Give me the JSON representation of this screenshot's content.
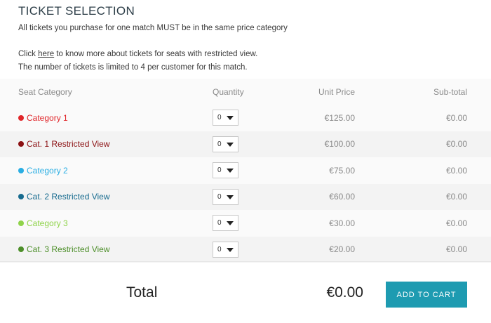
{
  "header": {
    "title": "TICKET SELECTION",
    "line1": "All tickets you purchase for one match MUST be in the same price category",
    "line2_prefix": "Click ",
    "line2_link": "here",
    "line2_suffix": " to know more about tickets for seats with restricted view.",
    "line3": "The number of tickets is limited to 4 per customer for this match."
  },
  "table": {
    "columns": {
      "category": "Seat Category",
      "quantity": "Quantity",
      "unit_price": "Unit Price",
      "subtotal": "Sub-total"
    },
    "rows": [
      {
        "category": "Category 1",
        "color": "#e0262a",
        "quantity": "0",
        "unit_price": "€125.00",
        "subtotal": "€0.00"
      },
      {
        "category": "Cat. 1 Restricted View",
        "color": "#8b1012",
        "quantity": "0",
        "unit_price": "€100.00",
        "subtotal": "€0.00"
      },
      {
        "category": "Category 2",
        "color": "#2aaee3",
        "quantity": "0",
        "unit_price": "€75.00",
        "subtotal": "€0.00"
      },
      {
        "category": "Cat. 2 Restricted View",
        "color": "#176b8f",
        "quantity": "0",
        "unit_price": "€60.00",
        "subtotal": "€0.00"
      },
      {
        "category": "Category 3",
        "color": "#8fd34a",
        "quantity": "0",
        "unit_price": "€30.00",
        "subtotal": "€0.00"
      },
      {
        "category": "Cat. 3 Restricted View",
        "color": "#4d8f2a",
        "quantity": "0",
        "unit_price": "€20.00",
        "subtotal": "€0.00"
      }
    ]
  },
  "footer": {
    "total_label": "Total",
    "total_value": "€0.00",
    "add_to_cart": "ADD TO CART",
    "button_color": "#1e9bb1"
  }
}
